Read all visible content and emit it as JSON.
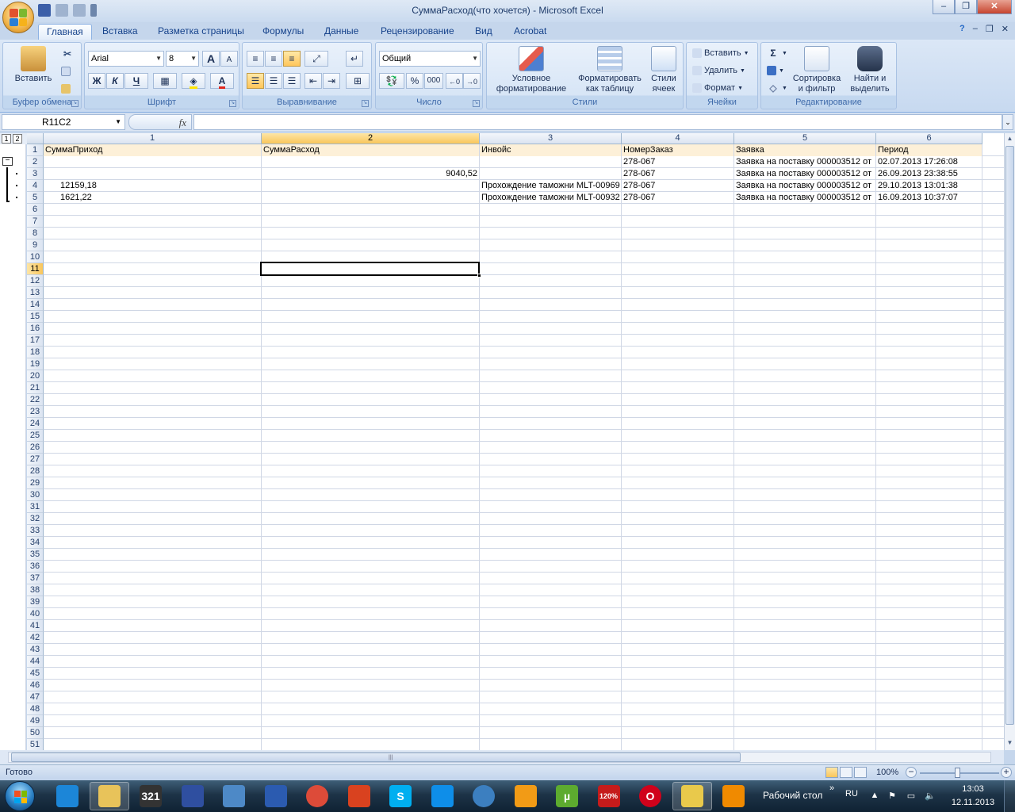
{
  "window": {
    "title": "СуммаРасход(что хочется) - Microsoft Excel"
  },
  "colors": {
    "ribbon_text": "#15428b",
    "header_fill": "#fdf0d8",
    "selected_header": "#f9c65b",
    "grid": "#d0d7e5"
  },
  "ribbon": {
    "tabs": [
      "Главная",
      "Вставка",
      "Разметка страницы",
      "Формулы",
      "Данные",
      "Рецензирование",
      "Вид",
      "Acrobat"
    ],
    "clipboard": {
      "paste_label": "Вставить",
      "group": "Буфер обмена"
    },
    "font": {
      "name": "Arial",
      "size": "8",
      "bold": "Ж",
      "italic": "К",
      "underline": "Ч",
      "grow": "A",
      "shrink": "A",
      "font_color": "A",
      "group": "Шрифт"
    },
    "alignment": {
      "group": "Выравнивание"
    },
    "number": {
      "format": "Общий",
      "percent": "%",
      "thousands": "000",
      "group": "Число"
    },
    "styles": {
      "conditional_l1": "Условное",
      "conditional_l2": "форматирование",
      "table_l1": "Форматировать",
      "table_l2": "как таблицу",
      "cell_l1": "Стили",
      "cell_l2": "ячеек",
      "group": "Стили"
    },
    "cells": {
      "insert": "Вставить",
      "delete": "Удалить",
      "format": "Формат",
      "group": "Ячейки"
    },
    "editing": {
      "sigma": "Σ",
      "sort_l1": "Сортировка",
      "sort_l2": "и фильтр",
      "find_l1": "Найти и",
      "find_l2": "выделить",
      "group": "Редактирование"
    }
  },
  "formula_bar": {
    "name_box": "R11C2",
    "fx": "fx",
    "formula": ""
  },
  "outline": {
    "levels": [
      "1",
      "2"
    ],
    "collapse": "−"
  },
  "sheet": {
    "columns": [
      "1",
      "2",
      "3",
      "4",
      "5",
      "6"
    ],
    "selected_column": "2",
    "selected_row": "11",
    "row_count": 51,
    "rows": [
      [
        "СуммаПриход",
        "СуммаРасход",
        "Инвойс",
        "НомерЗаказ",
        "Заявка",
        "Период"
      ],
      [
        "",
        "",
        "",
        "278-067",
        "Заявка на поставку 000003512 от",
        "02.07.2013 17:26:08"
      ],
      [
        "",
        "9040,52",
        "",
        "278-067",
        "Заявка на поставку 000003512 от",
        "26.09.2013 23:38:55"
      ],
      [
        "12159,18",
        "",
        "Прохождение таможни MLT-00969",
        "278-067",
        "Заявка на поставку 000003512 от",
        "29.10.2013 13:01:38"
      ],
      [
        "1621,22",
        "",
        "Прохождение таможни MLT-00932",
        "278-067",
        "Заявка на поставку 000003512 от",
        "16.09.2013 10:37:07"
      ]
    ]
  },
  "status": {
    "ready": "Готово",
    "zoom": "100%",
    "zoom_minus": "−",
    "zoom_plus": "+"
  },
  "taskbar": {
    "desktop": "Рабочий стол",
    "chevron": "»",
    "lang": "RU",
    "time": "13:03",
    "date": "12.11.2013",
    "apps": [
      "ie-icon",
      "explorer-icon",
      "calendar-icon",
      "save-icon",
      "mail-icon",
      "grid-icon",
      "chrome-icon",
      "pencil-icon",
      "skype-icon",
      "teamviewer-icon",
      "shield-icon",
      "aimp-icon",
      "utorrent-icon",
      "autocad-icon",
      "opera-icon",
      "excel-icon",
      "vlc-icon"
    ],
    "app_labels": {
      "calendar": "321",
      "skype": "S",
      "utorrent": "µ",
      "opera": "O",
      "autocad": "120%"
    }
  }
}
